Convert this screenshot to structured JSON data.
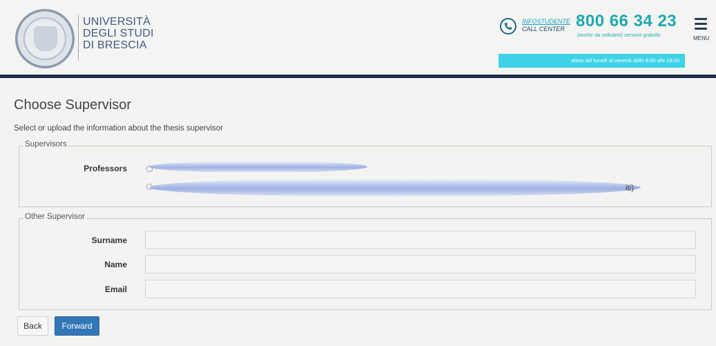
{
  "header": {
    "university_lines": [
      "UNIVERSITÀ",
      "DEGLI STUDI",
      "DI BRESCIA"
    ],
    "infostudente_label": "INFOSTUDENTE",
    "call_center_label": "CALL CENTER",
    "phone_number": "800 66 34 23",
    "phone_note": "(anche da cellulare) servizio gratuito",
    "hours_banner": "attivo dal lunedì al venerdì dalle 8:00 alle 18:00",
    "menu_label": "MENU",
    "menu_icon": "hamburger-icon",
    "phone_icon": "phone-icon"
  },
  "page": {
    "title": "Choose Supervisor",
    "subtitle": "Select or upload the information about the thesis supervisor"
  },
  "supervisors": {
    "legend": "Supervisors",
    "professors_label": "Professors",
    "option_2_tail": "iti)"
  },
  "other_supervisor": {
    "legend": "Other Supervisor",
    "surname_label": "Surname",
    "name_label": "Name",
    "email_label": "Email",
    "surname_value": "",
    "name_value": "",
    "email_value": ""
  },
  "actions": {
    "back_label": "Back",
    "forward_label": "Forward"
  },
  "colors": {
    "header_bar": "#1d2f46",
    "accent_teal": "#1ea7b0",
    "banner_cyan": "#3fd3e8",
    "primary_button": "#3176b6"
  }
}
